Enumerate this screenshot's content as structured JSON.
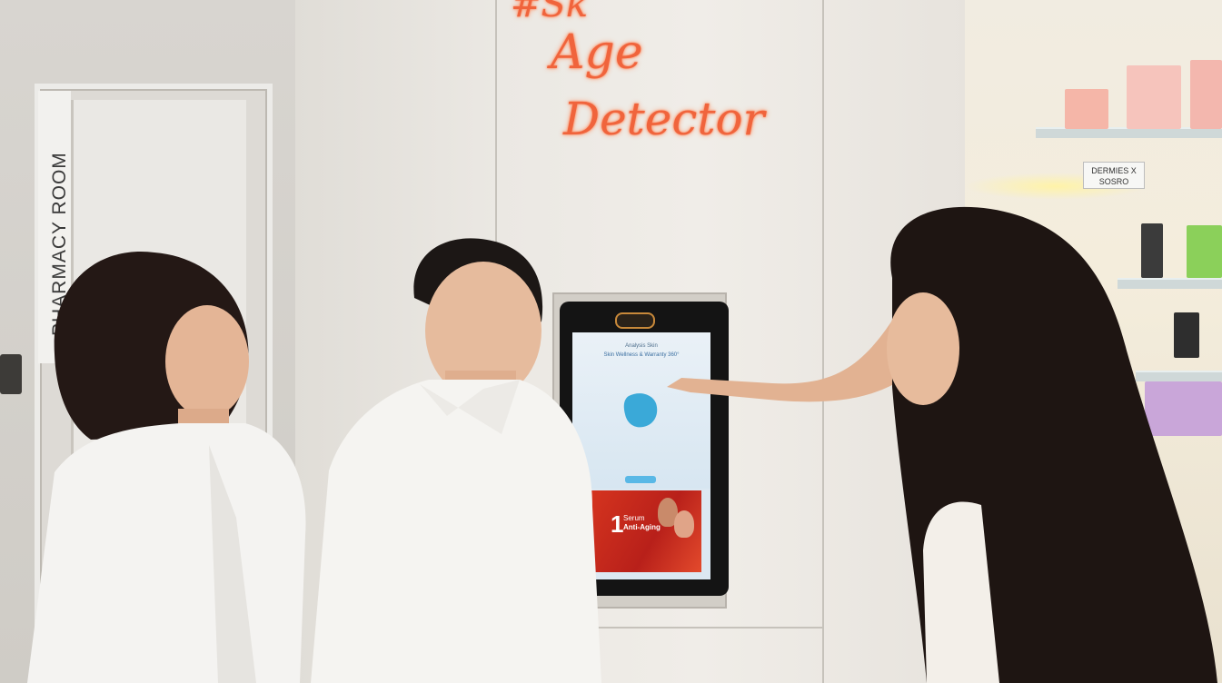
{
  "door_sign": {
    "text": "PHARMACY ROOM"
  },
  "neon_sign": {
    "hashtag": "#Sk",
    "line1": "Age",
    "line2": "Detector"
  },
  "kiosk": {
    "screen_title": "Analysis Skin",
    "screen_subtitle": "Skin Wellness & Warranty 360°",
    "banner_digit": "1",
    "banner_line1": "Serum",
    "banner_line2": "Anti-Aging"
  },
  "store_sign": {
    "line1": "DERMIES X",
    "line2": "SOSRO"
  },
  "colors": {
    "neon": "#f0643c",
    "kiosk_screen": "#dce8f2",
    "banner_red": "#d8361f"
  }
}
